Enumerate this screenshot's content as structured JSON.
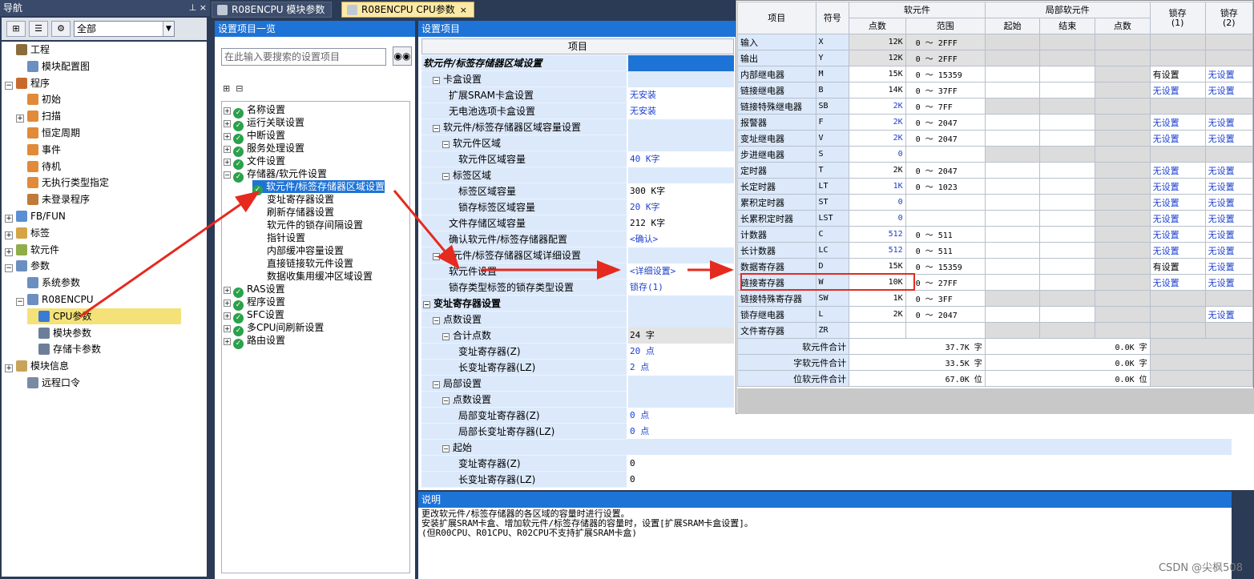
{
  "nav": {
    "title": "导航",
    "pin_label": "⊥ ×",
    "filter_value": "全部",
    "items": [
      {
        "label": "工程",
        "expander": ""
      },
      {
        "label": "模块配置图",
        "expander": ""
      },
      {
        "label": "程序",
        "expander": "−"
      },
      {
        "label": "初始",
        "expander": ""
      },
      {
        "label": "扫描",
        "expander": "+"
      },
      {
        "label": "恒定周期",
        "expander": ""
      },
      {
        "label": "事件",
        "expander": ""
      },
      {
        "label": "待机",
        "expander": ""
      },
      {
        "label": "无执行类型指定",
        "expander": ""
      },
      {
        "label": "未登录程序",
        "expander": ""
      },
      {
        "label": "FB/FUN",
        "expander": "+"
      },
      {
        "label": "标签",
        "expander": "+"
      },
      {
        "label": "软元件",
        "expander": "+"
      },
      {
        "label": "参数",
        "expander": "−"
      },
      {
        "label": "系统参数",
        "expander": ""
      },
      {
        "label": "R08ENCPU",
        "expander": "−"
      },
      {
        "label": "CPU参数",
        "expander": ""
      },
      {
        "label": "模块参数",
        "expander": ""
      },
      {
        "label": "存储卡参数",
        "expander": ""
      },
      {
        "label": "模块信息",
        "expander": "+"
      },
      {
        "label": "远程口令",
        "expander": ""
      }
    ]
  },
  "tabs": [
    {
      "label": "R08ENCPU 模块参数"
    },
    {
      "label": "R08ENCPU CPU参数",
      "close": "×"
    }
  ],
  "setlist": {
    "title": "设置项目一览",
    "search_placeholder": "在此输入要搜索的设置项目",
    "items": [
      {
        "label": "名称设置",
        "expander": "+"
      },
      {
        "label": "运行关联设置",
        "expander": "+"
      },
      {
        "label": "中断设置",
        "expander": "+"
      },
      {
        "label": "服务处理设置",
        "expander": "+"
      },
      {
        "label": "文件设置",
        "expander": "+"
      },
      {
        "label": "存储器/软元件设置",
        "expander": "−"
      },
      {
        "label": "软元件/标签存储器区域设置",
        "expander": ""
      },
      {
        "label": "变址寄存器设置",
        "expander": ""
      },
      {
        "label": "刷新存储器设置",
        "expander": ""
      },
      {
        "label": "软元件的锁存间隔设置",
        "expander": ""
      },
      {
        "label": "指针设置",
        "expander": ""
      },
      {
        "label": "内部缓冲容量设置",
        "expander": ""
      },
      {
        "label": "直接链接软元件设置",
        "expander": ""
      },
      {
        "label": "数据收集用缓冲区域设置",
        "expander": ""
      },
      {
        "label": "RAS设置",
        "expander": "+"
      },
      {
        "label": "程序设置",
        "expander": "+"
      },
      {
        "label": "SFC设置",
        "expander": "+"
      },
      {
        "label": "多CPU间刷新设置",
        "expander": "+"
      },
      {
        "label": "路由设置",
        "expander": "+"
      }
    ]
  },
  "items": {
    "title": "设置项目",
    "column_header": "项目",
    "rows": [
      {
        "label": "软元件/标签存储器区域设置",
        "value": ""
      },
      {
        "label": "卡盒设置",
        "value": ""
      },
      {
        "label": "扩展SRAM卡盒设置",
        "value": "无安装"
      },
      {
        "label": "无电池选项卡盒设置",
        "value": "无安装"
      },
      {
        "label": "软元件/标签存储器区域容量设置",
        "value": ""
      },
      {
        "label": "软元件区域",
        "value": ""
      },
      {
        "label": "软元件区域容量",
        "value": "40 K字"
      },
      {
        "label": "标签区域",
        "value": ""
      },
      {
        "label": "标签区域容量",
        "value": "300 K字"
      },
      {
        "label": "锁存标签区域容量",
        "value": "20 K字"
      },
      {
        "label": "文件存储区域容量",
        "value": "212 K字"
      },
      {
        "label": "确认软元件/标签存储器配置",
        "value": "<确认>"
      },
      {
        "label": "软元件/标签存储器区域详细设置",
        "value": ""
      },
      {
        "label": "软元件设置",
        "value": "<详细设置>"
      },
      {
        "label": "锁存类型标签的锁存类型设置",
        "value": "锁存(1)"
      },
      {
        "label": "变址寄存器设置",
        "value": ""
      },
      {
        "label": "点数设置",
        "value": ""
      },
      {
        "label": "合计点数",
        "value": "24 字"
      },
      {
        "label": "变址寄存器(Z)",
        "value": "20 点"
      },
      {
        "label": "长变址寄存器(LZ)",
        "value": "2 点"
      },
      {
        "label": "局部设置",
        "value": ""
      },
      {
        "label": "点数设置",
        "value": ""
      },
      {
        "label": "局部变址寄存器(Z)",
        "value": "0 点"
      },
      {
        "label": "局部长变址寄存器(LZ)",
        "value": "0 点"
      },
      {
        "label": "起始",
        "value": ""
      },
      {
        "label": "变址寄存器(Z)",
        "value": "0"
      },
      {
        "label": "长变址寄存器(LZ)",
        "value": "0"
      }
    ]
  },
  "description": {
    "title": "说明",
    "text": "更改软元件/标签存储器的各区域的容量时进行设置。\n安装扩展SRAM卡盒、增加软元件/标签存储器的容量时，设置[扩展SRAM卡盒设置]。\n(但R00CPU、R01CPU、R02CPU不支持扩展SRAM卡盒)"
  },
  "device_table": {
    "headers": {
      "item": "项目",
      "symbol": "符号",
      "device": "软元件",
      "points": "点数",
      "range": "范围",
      "local": "局部软元件",
      "start": "起始",
      "end": "结束",
      "local_points": "点数",
      "latch1": "锁存\n(1)",
      "latch2": "锁存\n(2)"
    },
    "rows": [
      {
        "name": "输入",
        "sym": "X",
        "pts": "12K",
        "range": "0 ～ 2FFF",
        "l1": "",
        "l2": ""
      },
      {
        "name": "输出",
        "sym": "Y",
        "pts": "12K",
        "range": "0 ～ 2FFF",
        "l1": "",
        "l2": ""
      },
      {
        "name": "内部继电器",
        "sym": "M",
        "pts": "15K",
        "range": "0 ～ 15359",
        "l1": "有设置",
        "l2": "无设置"
      },
      {
        "name": "链接继电器",
        "sym": "B",
        "pts": "14K",
        "range": "0 ～ 37FF",
        "l1": "无设置",
        "l2": "无设置"
      },
      {
        "name": "链接特殊继电器",
        "sym": "SB",
        "pts": "2K",
        "range": "0 ～ 7FF",
        "l1": "",
        "l2": ""
      },
      {
        "name": "报警器",
        "sym": "F",
        "pts": "2K",
        "range": "0 ～ 2047",
        "l1": "无设置",
        "l2": "无设置"
      },
      {
        "name": "变址继电器",
        "sym": "V",
        "pts": "2K",
        "range": "0 ～ 2047",
        "l1": "无设置",
        "l2": "无设置"
      },
      {
        "name": "步进继电器",
        "sym": "S",
        "pts": "0",
        "range": "",
        "l1": "",
        "l2": ""
      },
      {
        "name": "定时器",
        "sym": "T",
        "pts": "2K",
        "range": "0 ～ 2047",
        "l1": "无设置",
        "l2": "无设置"
      },
      {
        "name": "长定时器",
        "sym": "LT",
        "pts": "1K",
        "range": "0 ～ 1023",
        "l1": "无设置",
        "l2": "无设置"
      },
      {
        "name": "累积定时器",
        "sym": "ST",
        "pts": "0",
        "range": "",
        "l1": "无设置",
        "l2": "无设置"
      },
      {
        "name": "长累积定时器",
        "sym": "LST",
        "pts": "0",
        "range": "",
        "l1": "无设置",
        "l2": "无设置"
      },
      {
        "name": "计数器",
        "sym": "C",
        "pts": "512",
        "range": "0 ～ 511",
        "l1": "无设置",
        "l2": "无设置"
      },
      {
        "name": "长计数器",
        "sym": "LC",
        "pts": "512",
        "range": "0 ～ 511",
        "l1": "无设置",
        "l2": "无设置"
      },
      {
        "name": "数据寄存器",
        "sym": "D",
        "pts": "15K",
        "range": "0 ～ 15359",
        "l1": "有设置",
        "l2": "无设置"
      },
      {
        "name": "链接寄存器",
        "sym": "W",
        "pts": "10K",
        "range": "0 ～ 27FF",
        "l1": "无设置",
        "l2": "无设置"
      },
      {
        "name": "链接特殊寄存器",
        "sym": "SW",
        "pts": "1K",
        "range": "0 ～ 3FF",
        "l1": "",
        "l2": ""
      },
      {
        "name": "锁存继电器",
        "sym": "L",
        "pts": "2K",
        "range": "0 ～ 2047",
        "l1": "",
        "l2": "无设置"
      },
      {
        "name": "文件寄存器",
        "sym": "ZR",
        "pts": "",
        "range": "",
        "l1": "",
        "l2": ""
      }
    ],
    "totals": [
      {
        "label": "软元件合计",
        "device": "37.7K 字",
        "local": "0.0K 字"
      },
      {
        "label": "字软元件合计",
        "device": "33.5K 字",
        "local": "0.0K 字"
      },
      {
        "label": "位软元件合计",
        "device": "67.0K 位",
        "local": "0.0K 位"
      }
    ]
  },
  "watermark": "CSDN @尖枫508",
  "colors": {
    "accent": "#1e73d6",
    "highlight_box": "#e52a1f",
    "arrow": "#e52a1f",
    "selection": "#f4e279"
  }
}
